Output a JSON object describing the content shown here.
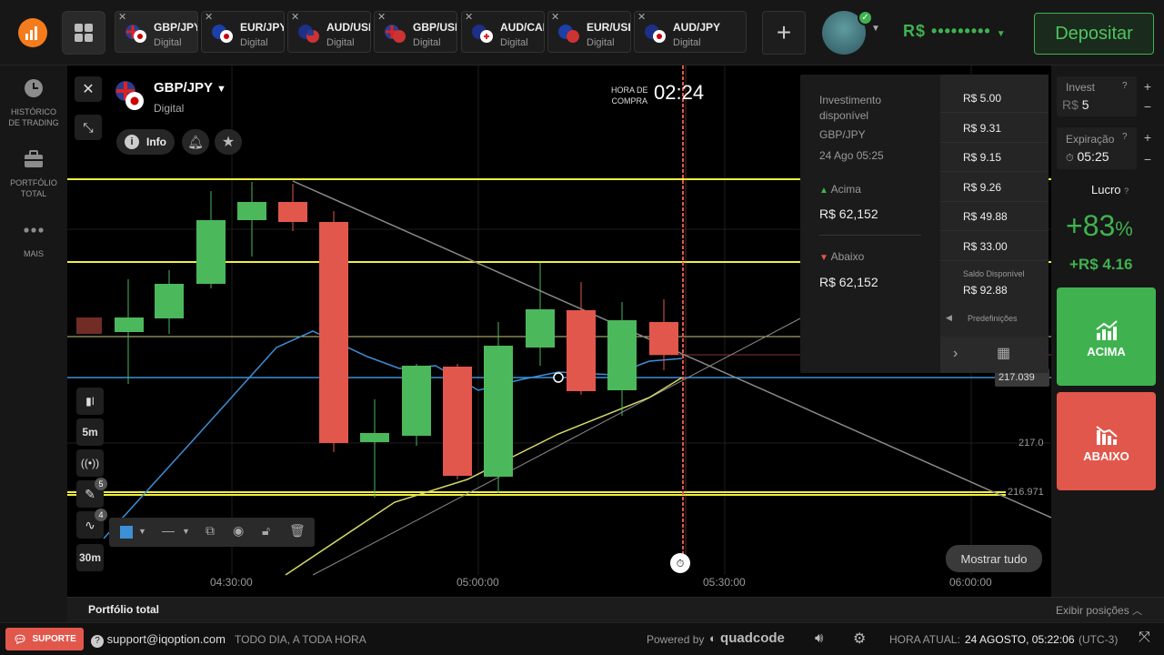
{
  "header": {
    "tabs": [
      {
        "pair": "GBP/JPY",
        "type": "Digital",
        "active": true
      },
      {
        "pair": "EUR/JPY",
        "type": "Digital",
        "active": false
      },
      {
        "pair": "AUD/USD",
        "type": "Digital",
        "active": false
      },
      {
        "pair": "GBP/USD",
        "type": "Digital",
        "active": false
      },
      {
        "pair": "AUD/CAD",
        "type": "Digital",
        "active": false
      },
      {
        "pair": "EUR/USD",
        "type": "Digital",
        "active": false
      },
      {
        "pair": "AUD/JPY",
        "type": "Digital",
        "active": false
      }
    ],
    "balance": "R$ •••••••••",
    "deposit_label": "Depositar"
  },
  "sidebar": {
    "items": [
      {
        "label": "HISTÓRICO DE TRADING",
        "icon": "clock-icon"
      },
      {
        "label": "PORTFÓLIO TOTAL",
        "icon": "briefcase-icon"
      },
      {
        "label": "MAIS",
        "icon": "more-icon"
      }
    ]
  },
  "chart": {
    "asset": "GBP/JPY",
    "asset_type": "Digital",
    "info_label": "Info",
    "purchase_label_1": "HORA DE",
    "purchase_label_2": "COMPRA",
    "purchase_timer": "02:24",
    "price_current": "217.039",
    "price_217": "217.0",
    "price_216971": "216.971",
    "show_all_label": "Mostrar tudo",
    "time_labels": [
      "04:30:00",
      "05:00:00",
      "05:30:00",
      "06:00:00"
    ],
    "timeframe_candle": "5m",
    "timeframe_bottom": "30m",
    "badge_draw": "5",
    "badge_indicator": "4",
    "colors": {
      "up": "#4cb85c",
      "down": "#e2574c",
      "ma_blue": "#3d8fd6",
      "level_yellow": "#f0f03a",
      "trend_yellow": "#d8d86a"
    }
  },
  "invest_panel": {
    "available_label_1": "Investimento",
    "available_label_2": "disponível",
    "asset": "GBP/JPY",
    "date": "24 Ago 05:25",
    "up_label": "Acima",
    "up_value": "R$ 62,152",
    "down_label": "Abaixo",
    "down_value": "R$ 62,152",
    "presets": [
      "R$ 5.00",
      "R$ 9.31",
      "R$ 9.15",
      "R$ 9.26",
      "R$ 49.88",
      "R$ 33.00"
    ],
    "saldo_label": "Saldo Disponível",
    "saldo_value": "R$ 92.88",
    "predef_label": "Predefinições"
  },
  "trade": {
    "invest_label": "Invest",
    "currency": "R$",
    "amount": "5",
    "expiry_label": "Expiração",
    "expiry_time": "05:25",
    "profit_label": "Lucro",
    "profit_pct": "+83",
    "pct_sign": "%",
    "profit_value": "+R$ 4.16",
    "up_button": "ACIMA",
    "down_button": "ABAIXO"
  },
  "footer": {
    "portfolio_label": "Portfólio total",
    "positions_label": "Exibir posições",
    "support_label": "SUPORTE",
    "support_email": "support@iqoption.com",
    "support_hours": "TODO DIA, A TODA HORA",
    "powered_by": "Powered by",
    "brand": "quadcode",
    "time_label": "HORA ATUAL:",
    "time_value": "24 AGOSTO, 05:22:06",
    "tz": "(UTC-3)"
  }
}
